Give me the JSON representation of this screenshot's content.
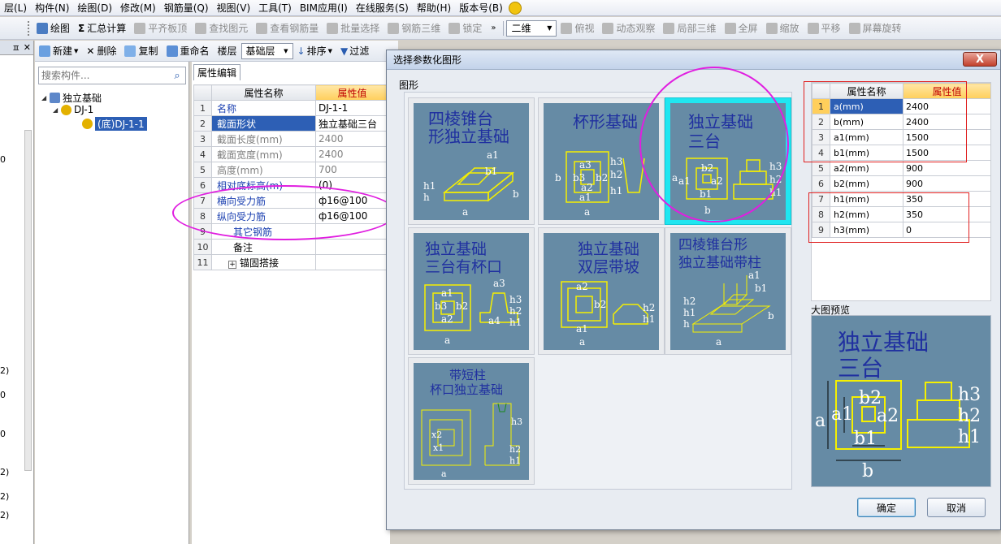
{
  "menubar": {
    "items": [
      "层(L)",
      "构件(N)",
      "绘图(D)",
      "修改(M)",
      "钢筋量(Q)",
      "视图(V)",
      "工具(T)",
      "BIM应用(I)",
      "在线服务(S)",
      "帮助(H)",
      "版本号(B)"
    ]
  },
  "toolbar1": {
    "draw": "绘图",
    "summary": "汇总计算",
    "align_top": "平齐板顶",
    "find": "查找图元",
    "view_rebar": "查看钢筋量",
    "batch_select": "批量选择",
    "rebar_3d": "钢筋三维",
    "lock": "锁定",
    "view_2d": "二维",
    "top_view": "俯视",
    "orbit": "动态观察",
    "local_3d": "局部三维",
    "fullscreen": "全屏",
    "zoom": "缩放",
    "pan": "平移",
    "rotate": "屏幕旋转"
  },
  "toolbar2": {
    "new": "新建",
    "delete": "删除",
    "copy": "复制",
    "rename": "重命名",
    "floor_label": "楼层",
    "floor_value": "基础层",
    "sort": "排序",
    "filter": "过滤"
  },
  "leftstrip": {
    "labels": [
      "0",
      "2)",
      "0",
      "0",
      "2)",
      "2)",
      "2)"
    ]
  },
  "tree": {
    "search_placeholder": "搜索构件...",
    "root": "独立基础",
    "child": "DJ-1",
    "leaf": "(底)DJ-1-1"
  },
  "props": {
    "tab": "属性编辑",
    "col_name": "属性名称",
    "col_value": "属性值",
    "rows": [
      {
        "n": "1",
        "name": "名称",
        "value": "DJ-1-1"
      },
      {
        "n": "2",
        "name": "截面形状",
        "value": "独立基础三台"
      },
      {
        "n": "3",
        "name": "截面长度(mm)",
        "value": "2400"
      },
      {
        "n": "4",
        "name": "截面宽度(mm)",
        "value": "2400"
      },
      {
        "n": "5",
        "name": "高度(mm)",
        "value": "700"
      },
      {
        "n": "6",
        "name": "相对底标高(m)",
        "value": "(0)"
      },
      {
        "n": "7",
        "name": "横向受力筋",
        "value": "ф16@100"
      },
      {
        "n": "8",
        "name": "纵向受力筋",
        "value": "ф16@100"
      },
      {
        "n": "9",
        "name": "其它钢筋",
        "value": ""
      },
      {
        "n": "10",
        "name": "备注",
        "value": ""
      },
      {
        "n": "11",
        "name": "锚固搭接",
        "value": ""
      }
    ]
  },
  "dialog": {
    "title": "选择参数化图形",
    "close": "X",
    "group_label": "图形",
    "shapes": [
      {
        "line1": "四棱锥台",
        "line2": "形独立基础",
        "labels": [
          "a1",
          "b1",
          "h1",
          "h",
          "a",
          "b"
        ]
      },
      {
        "line1": "杯形基础",
        "line2": "",
        "labels": [
          "a3",
          "b3",
          "b2",
          "a2",
          "a1",
          "h3",
          "h2",
          "h1",
          "b",
          "a"
        ]
      },
      {
        "line1": "独立基础",
        "line2": "三台",
        "labels": [
          "h3",
          "h2",
          "h1",
          "b2",
          "a2",
          "a1",
          "b1",
          "a",
          "b"
        ]
      },
      {
        "line1": "独立基础",
        "line2": "三台有杯口",
        "labels": [
          "a3",
          "a1",
          "a2",
          "b3",
          "b2",
          "h3",
          "h2",
          "h1",
          "a4",
          "a"
        ]
      },
      {
        "line1": "独立基础",
        "line2": "双层带坡",
        "labels": [
          "a2",
          "b2",
          "a1",
          "h2",
          "h1",
          "a"
        ]
      },
      {
        "line1": "四棱锥台形",
        "line2": "独立基础带柱",
        "labels": [
          "a1",
          "b1",
          "h2",
          "h1",
          "h",
          "a",
          "b"
        ]
      },
      {
        "line1": "带短柱",
        "line2": "杯口独立基础",
        "labels": [
          "h3",
          "h2",
          "h1",
          "x2",
          "x1",
          "a"
        ]
      }
    ],
    "param_col_name": "属性名称",
    "param_col_value": "属性值",
    "params": [
      {
        "n": "1",
        "name": "a(mm)",
        "value": "2400"
      },
      {
        "n": "2",
        "name": "b(mm)",
        "value": "2400"
      },
      {
        "n": "3",
        "name": "a1(mm)",
        "value": "1500"
      },
      {
        "n": "4",
        "name": "b1(mm)",
        "value": "1500"
      },
      {
        "n": "5",
        "name": "a2(mm)",
        "value": "900"
      },
      {
        "n": "6",
        "name": "b2(mm)",
        "value": "900"
      },
      {
        "n": "7",
        "name": "h1(mm)",
        "value": "350"
      },
      {
        "n": "8",
        "name": "h2(mm)",
        "value": "350"
      },
      {
        "n": "9",
        "name": "h3(mm)",
        "value": "0"
      }
    ],
    "preview_label": "大图预览",
    "preview_title1": "独立基础",
    "preview_title2": "三台",
    "preview_labels": [
      "h3",
      "h2",
      "h1",
      "b2",
      "a2",
      "a",
      "a1",
      "b1",
      "b"
    ],
    "ok": "确定",
    "cancel": "取消"
  },
  "colors": {
    "accent_selection": "#2d5fb5",
    "value_header": "#ffcf5b",
    "annotation_circle": "#e01ee0",
    "annotation_box": "#e02020",
    "thumbnail_bg": "#668ba5",
    "thumbnail_lines": "#f5f000",
    "selected_tile": "#20e6f0"
  }
}
